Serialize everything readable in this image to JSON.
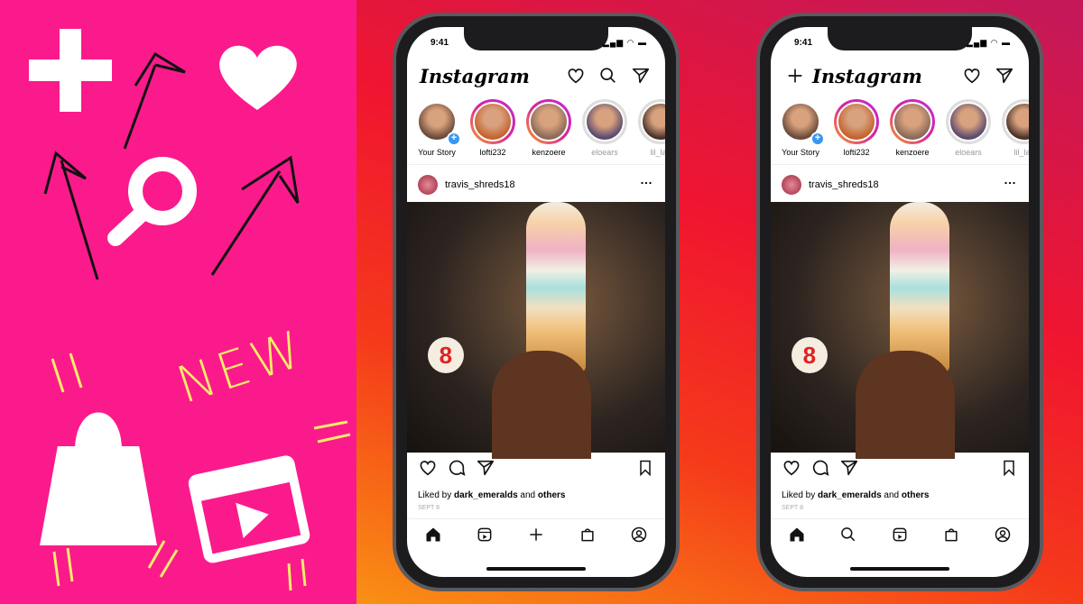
{
  "promo": {
    "new_text": "NEW",
    "bg_color": "#fb1a8c",
    "doodle_icons": [
      "plus-icon",
      "heart-icon",
      "search-icon",
      "shopping-bag-icon",
      "reels-clapper-icon",
      "arrow-icon"
    ]
  },
  "phones": [
    {
      "time": "9:41",
      "app_title": "Instagram",
      "top_icons": [
        "heart-icon",
        "search-icon",
        "direct-message-icon"
      ],
      "stories": [
        {
          "label": "Your Story",
          "own": true,
          "color": "#6b4a3a"
        },
        {
          "label": "lofti232",
          "color": "#c4632f"
        },
        {
          "label": "kenzoere",
          "color": "#8a6a58"
        },
        {
          "label": "eloears",
          "seen": true,
          "color": "#5b4a6e"
        },
        {
          "label": "lil_lap",
          "seen": true,
          "color": "#4a3328"
        }
      ],
      "post": {
        "user": "travis_shreds18",
        "liked_by": "Liked by",
        "liked_user": "dark_emeralds",
        "and": "and",
        "others": "others",
        "date": "SEPT 8",
        "sign_text": "8"
      },
      "nav": [
        "home-icon",
        "reels-icon",
        "create-icon",
        "shop-icon",
        "profile-icon"
      ]
    },
    {
      "time": "9:41",
      "app_title": "Instagram",
      "top_icons": [
        "create-icon",
        "heart-icon",
        "direct-message-icon"
      ],
      "stories": [
        {
          "label": "Your Story",
          "own": true,
          "color": "#6b4a3a"
        },
        {
          "label": "lofti232",
          "color": "#c4632f"
        },
        {
          "label": "kenzoere",
          "color": "#8a6a58"
        },
        {
          "label": "eloears",
          "seen": true,
          "color": "#5b4a6e"
        },
        {
          "label": "lil_lap",
          "seen": true,
          "color": "#4a3328"
        }
      ],
      "post": {
        "user": "travis_shreds18",
        "liked_by": "Liked by",
        "liked_user": "dark_emeralds",
        "and": "and",
        "others": "others",
        "date": "SEPT 8",
        "sign_text": "8"
      },
      "nav": [
        "home-icon",
        "search-icon",
        "reels-icon",
        "shop-icon",
        "profile-icon"
      ]
    }
  ]
}
